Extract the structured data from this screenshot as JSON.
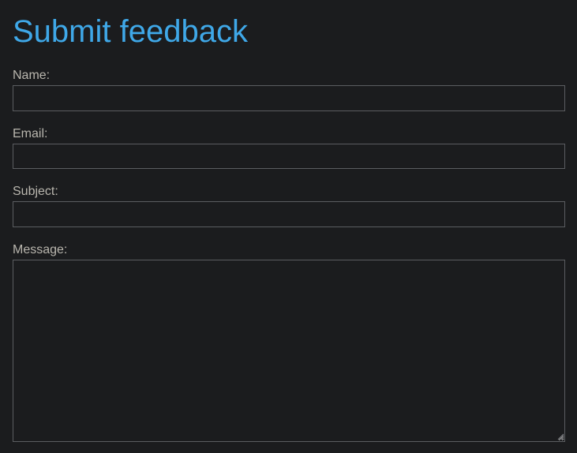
{
  "form": {
    "title": "Submit feedback",
    "fields": [
      {
        "label": "Name:",
        "value": "",
        "type": "text"
      },
      {
        "label": "Email:",
        "value": "",
        "type": "email"
      },
      {
        "label": "Subject:",
        "value": "",
        "type": "text"
      },
      {
        "label": "Message:",
        "value": "",
        "type": "textarea"
      }
    ]
  },
  "colors": {
    "background": "#1b1c1e",
    "title": "#3fa8e8",
    "label": "#b9b6ae",
    "input_border": "#5b5d61"
  },
  "icons": [
    "textarea-resize-grip-icon"
  ]
}
